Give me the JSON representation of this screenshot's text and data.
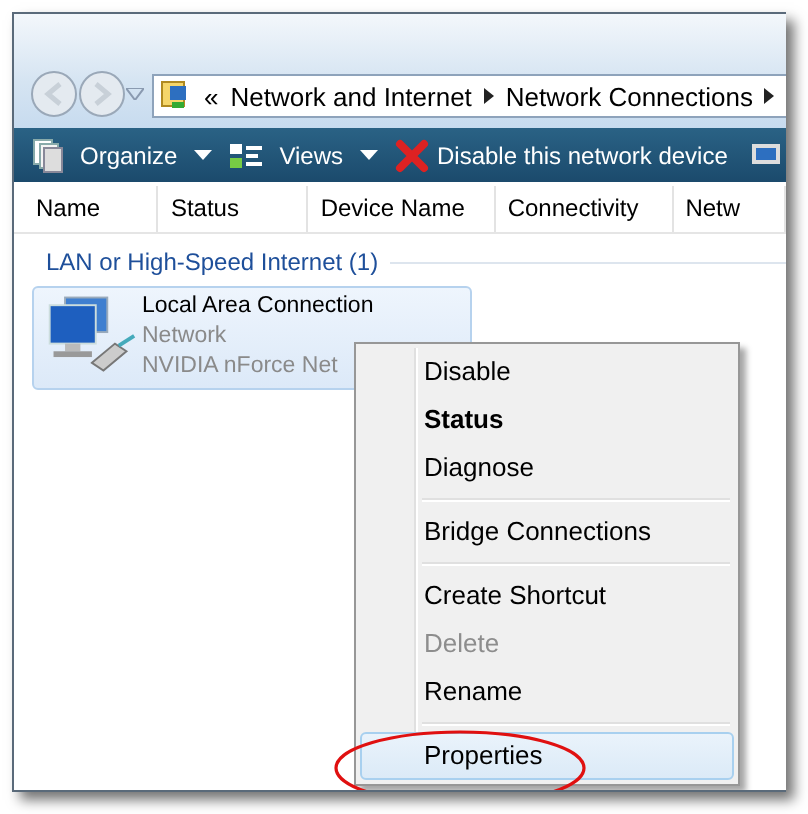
{
  "address_bar": {
    "overflow": "«",
    "path": [
      "Network and Internet",
      "Network Connections"
    ]
  },
  "toolbar": [
    {
      "kind": "organize",
      "label": "Organize",
      "dropdown": true
    },
    {
      "kind": "views",
      "label": "Views",
      "dropdown": true
    },
    {
      "kind": "disable",
      "label": "Disable this network device",
      "dropdown": false
    }
  ],
  "columns": [
    "Name",
    "Status",
    "Device Name",
    "Connectivity",
    "Netw"
  ],
  "groups": [
    {
      "label": "LAN or High-Speed Internet (1)",
      "items": [
        {
          "name": "Local Area Connection",
          "type": "Network",
          "device": "NVIDIA nForce Net",
          "selected": true
        }
      ]
    }
  ],
  "context_menu": [
    {
      "kind": "item",
      "label": "Disable",
      "default": false,
      "disabled": false,
      "selected": false
    },
    {
      "kind": "item",
      "label": "Status",
      "default": true,
      "disabled": false,
      "selected": false
    },
    {
      "kind": "item",
      "label": "Diagnose",
      "default": false,
      "disabled": false,
      "selected": false
    },
    {
      "kind": "separator"
    },
    {
      "kind": "item",
      "label": "Bridge Connections",
      "default": false,
      "disabled": false,
      "selected": false
    },
    {
      "kind": "separator"
    },
    {
      "kind": "item",
      "label": "Create Shortcut",
      "default": false,
      "disabled": false,
      "selected": false
    },
    {
      "kind": "item",
      "label": "Delete",
      "default": false,
      "disabled": true,
      "selected": false
    },
    {
      "kind": "item",
      "label": "Rename",
      "default": false,
      "disabled": false,
      "selected": false
    },
    {
      "kind": "separator"
    },
    {
      "kind": "item",
      "label": "Properties",
      "default": false,
      "disabled": false,
      "selected": true,
      "circled": true
    }
  ]
}
